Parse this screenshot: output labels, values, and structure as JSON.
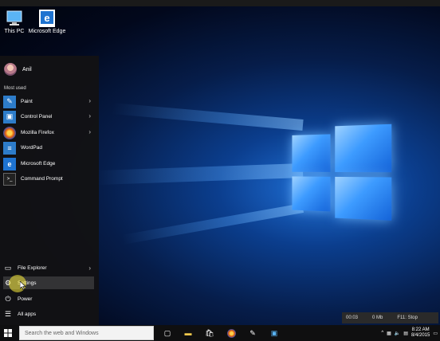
{
  "desktop": {
    "icons": [
      {
        "label": "This PC",
        "icon": "this-pc-icon"
      },
      {
        "label": "Microsoft Edge",
        "icon": "edge-icon"
      }
    ]
  },
  "start_menu": {
    "user_name": "Anil",
    "most_used_heading": "Most used",
    "most_used": [
      {
        "label": "Paint",
        "icon": "paint-icon",
        "color": "#2d7cc9",
        "has_submenu": true
      },
      {
        "label": "Control Panel",
        "icon": "control-panel-icon",
        "color": "#2d7cc9",
        "has_submenu": true
      },
      {
        "label": "Mozilla Firefox",
        "icon": "firefox-icon",
        "color": "#e8620e",
        "has_submenu": true
      },
      {
        "label": "WordPad",
        "icon": "wordpad-icon",
        "color": "#2d7cc9",
        "has_submenu": false
      },
      {
        "label": "Microsoft Edge",
        "icon": "edge-icon",
        "color": "#1e73d0",
        "has_submenu": false
      },
      {
        "label": "Command Prompt",
        "icon": "command-prompt-icon",
        "color": "#222222",
        "has_submenu": false
      }
    ],
    "file_explorer": "File Explorer",
    "settings": "Settings",
    "power": "Power",
    "all_apps": "All apps"
  },
  "taskbar": {
    "search_placeholder": "Search the web and Windows",
    "icons": [
      "task-view-icon",
      "file-explorer-icon",
      "store-icon",
      "firefox-icon",
      "paint-icon",
      "remote-icon"
    ],
    "time": "8:22 AM",
    "date": "8/4/2015"
  },
  "recorder": {
    "elapsed": "00:03",
    "size": "0 Mb",
    "hint": "F11: Stop"
  }
}
